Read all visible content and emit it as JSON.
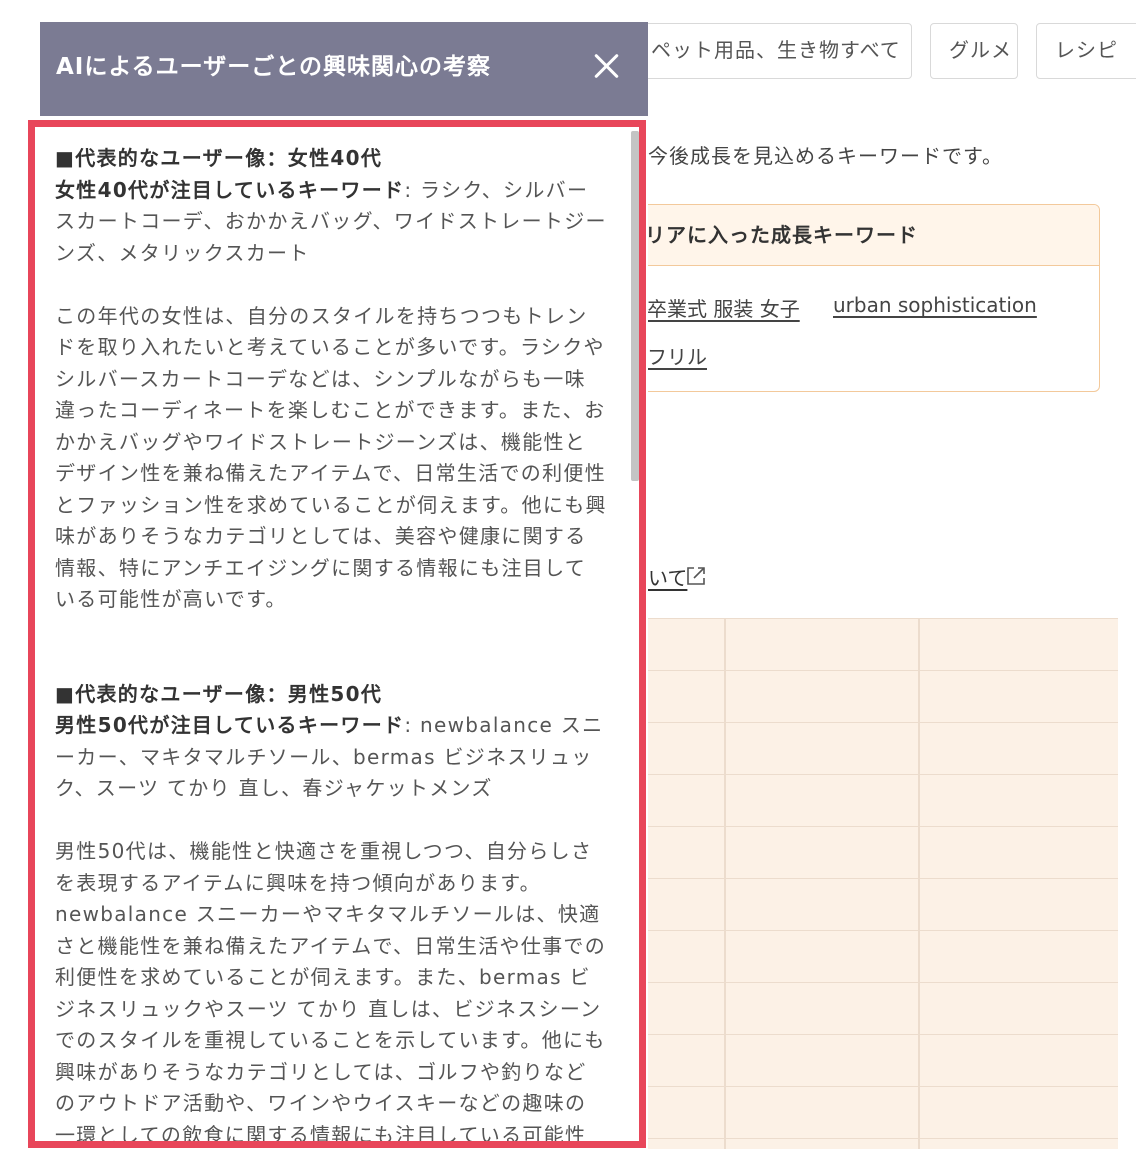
{
  "background": {
    "category_chips": [
      "ペット用品、生き物すべて",
      "グルメ",
      "レシピ"
    ],
    "description": "今後成長を見込めるキーワードです。",
    "growth_box": {
      "title": "リアに入った成長キーワード",
      "keywords": [
        "卒業式 服装 女子",
        "urban sophistication",
        "フリル"
      ]
    },
    "about_link": "いて"
  },
  "modal": {
    "title": "AIによるユーザーごとの興味関心の考察",
    "sections": [
      {
        "heading": "■代表的なユーザー像：女性40代",
        "keyword_label": "女性40代が注目しているキーワード",
        "keywords": ": ラシク、シルバースカートコーデ、おかかえバッグ、ワイドストレートジーンズ、メタリックスカート",
        "body": "この年代の女性は、自分のスタイルを持ちつつもトレンドを取り入れたいと考えていることが多いです。ラシクやシルバースカートコーデなどは、シンプルながらも一味違ったコーディネートを楽しむことができます。また、おかかえバッグやワイドストレートジーンズは、機能性とデザイン性を兼ね備えたアイテムで、日常生活での利便性とファッション性を求めていることが伺えます。他にも興味がありそうなカテゴリとしては、美容や健康に関する情報、特にアンチエイジングに関する情報にも注目している可能性が高いです。"
      },
      {
        "heading": "■代表的なユーザー像：男性50代",
        "keyword_label": "男性50代が注目しているキーワード",
        "keywords": ": newbalance スニーカー、マキタマルチソール、bermas ビジネスリュック、スーツ てかり 直し、春ジャケットメンズ",
        "body": "男性50代は、機能性と快適さを重視しつつ、自分らしさを表現するアイテムに興味を持つ傾向があります。newbalance スニーカーやマキタマルチソールは、快適さと機能性を兼ね備えたアイテムで、日常生活や仕事での利便性を求めていることが伺えます。また、bermas ビジネスリュックやスーツ てかり 直しは、ビジネスシーンでのスタイルを重視していることを示しています。他にも興味がありそうなカテゴリとしては、ゴルフや釣りなどのアウトドア活動や、ワインやウイスキーなどの趣味の一環としての飲食に関する情報にも注目している可能性が高いです。"
      }
    ]
  },
  "colors": {
    "header_bg": "#7b7b93",
    "highlight_border": "#e8465a",
    "growth_border": "#f3c99b",
    "table_bg": "#fcf1e6"
  }
}
